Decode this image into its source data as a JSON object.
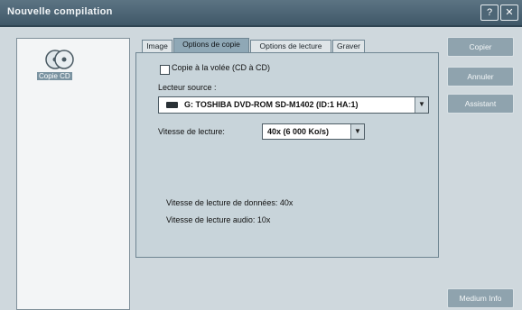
{
  "window": {
    "title": "Nouvelle compilation",
    "help_glyph": "?",
    "close_glyph": "✕"
  },
  "sidebar": {
    "item_label": "Copie CD",
    "item_icon": "cd-copy-icon"
  },
  "tabs": [
    {
      "label": "Image"
    },
    {
      "label": "Options de copie"
    },
    {
      "label": "Options de lecture"
    },
    {
      "label": "Graver"
    }
  ],
  "copy_options": {
    "onthefly_label": "Copie à la volée (CD à CD)",
    "onthefly_checked": false,
    "source_label": "Lecteur source :",
    "source_value": "G: TOSHIBA  DVD-ROM SD-M1402 (ID:1  HA:1)",
    "speed_label": "Vitesse de lecture:",
    "speed_value": "40x (6 000 Ko/s)",
    "data_speed_text": "Vitesse de lecture de données: 40x",
    "audio_speed_text": "Vitesse de lecture audio: 10x"
  },
  "buttons": {
    "copy": "Copier",
    "cancel": "Annuler",
    "wizard": "Assistant",
    "media_info": "Medium Info"
  },
  "colors": {
    "titlebar": "#4a6272",
    "active_tab": "#8fa8b6",
    "panel": "#c8d4da",
    "button": "#8fa3ae"
  }
}
